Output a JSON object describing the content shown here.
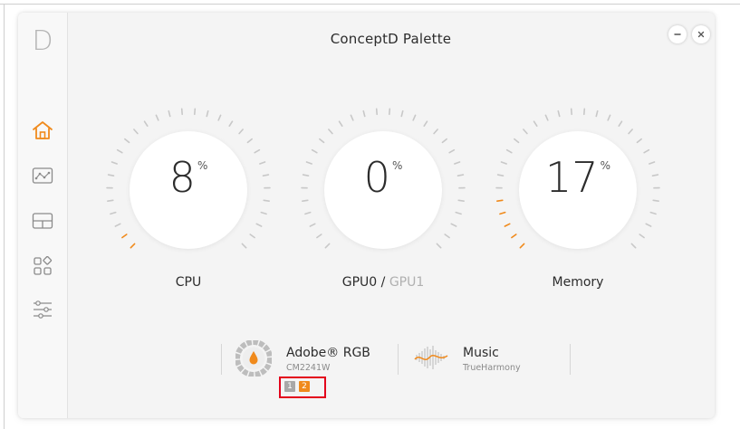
{
  "app": {
    "logo_letter": "D",
    "title": "ConceptD Palette"
  },
  "window_controls": {
    "minimize": "–",
    "close": "×"
  },
  "sidebar": {
    "items": [
      {
        "name": "home",
        "icon": "home-icon",
        "active": true
      },
      {
        "name": "monitor-graph",
        "icon": "graph-icon",
        "active": false
      },
      {
        "name": "layout",
        "icon": "layout-icon",
        "active": false
      },
      {
        "name": "apps",
        "icon": "apps-icon",
        "active": false
      },
      {
        "name": "settings",
        "icon": "sliders-icon",
        "active": false
      }
    ]
  },
  "gauges": [
    {
      "id": "cpu",
      "value": "8",
      "unit": "%",
      "percent": 8,
      "label": "CPU"
    },
    {
      "id": "gpu",
      "value": "0",
      "unit": "%",
      "percent": 0,
      "label_primary": "GPU0",
      "label_sep": " / ",
      "label_secondary": "GPU1"
    },
    {
      "id": "memory",
      "value": "17",
      "unit": "%",
      "percent": 17,
      "label": "Memory"
    }
  ],
  "profiles": {
    "color": {
      "title": "Adobe® RGB",
      "subtitle": "CM2241W",
      "icon": "color-profile-icon"
    },
    "audio": {
      "title": "Music",
      "subtitle": "TrueHarmony",
      "icon": "sound-wave-icon"
    },
    "monitors": [
      {
        "label": "1",
        "active": false
      },
      {
        "label": "2",
        "active": true
      }
    ]
  },
  "colors": {
    "accent": "#f08a1c",
    "tick_inactive": "#c8c8c8",
    "text": "#2c2c2c",
    "muted": "#b0b0b0",
    "highlight": "#e3001b"
  }
}
